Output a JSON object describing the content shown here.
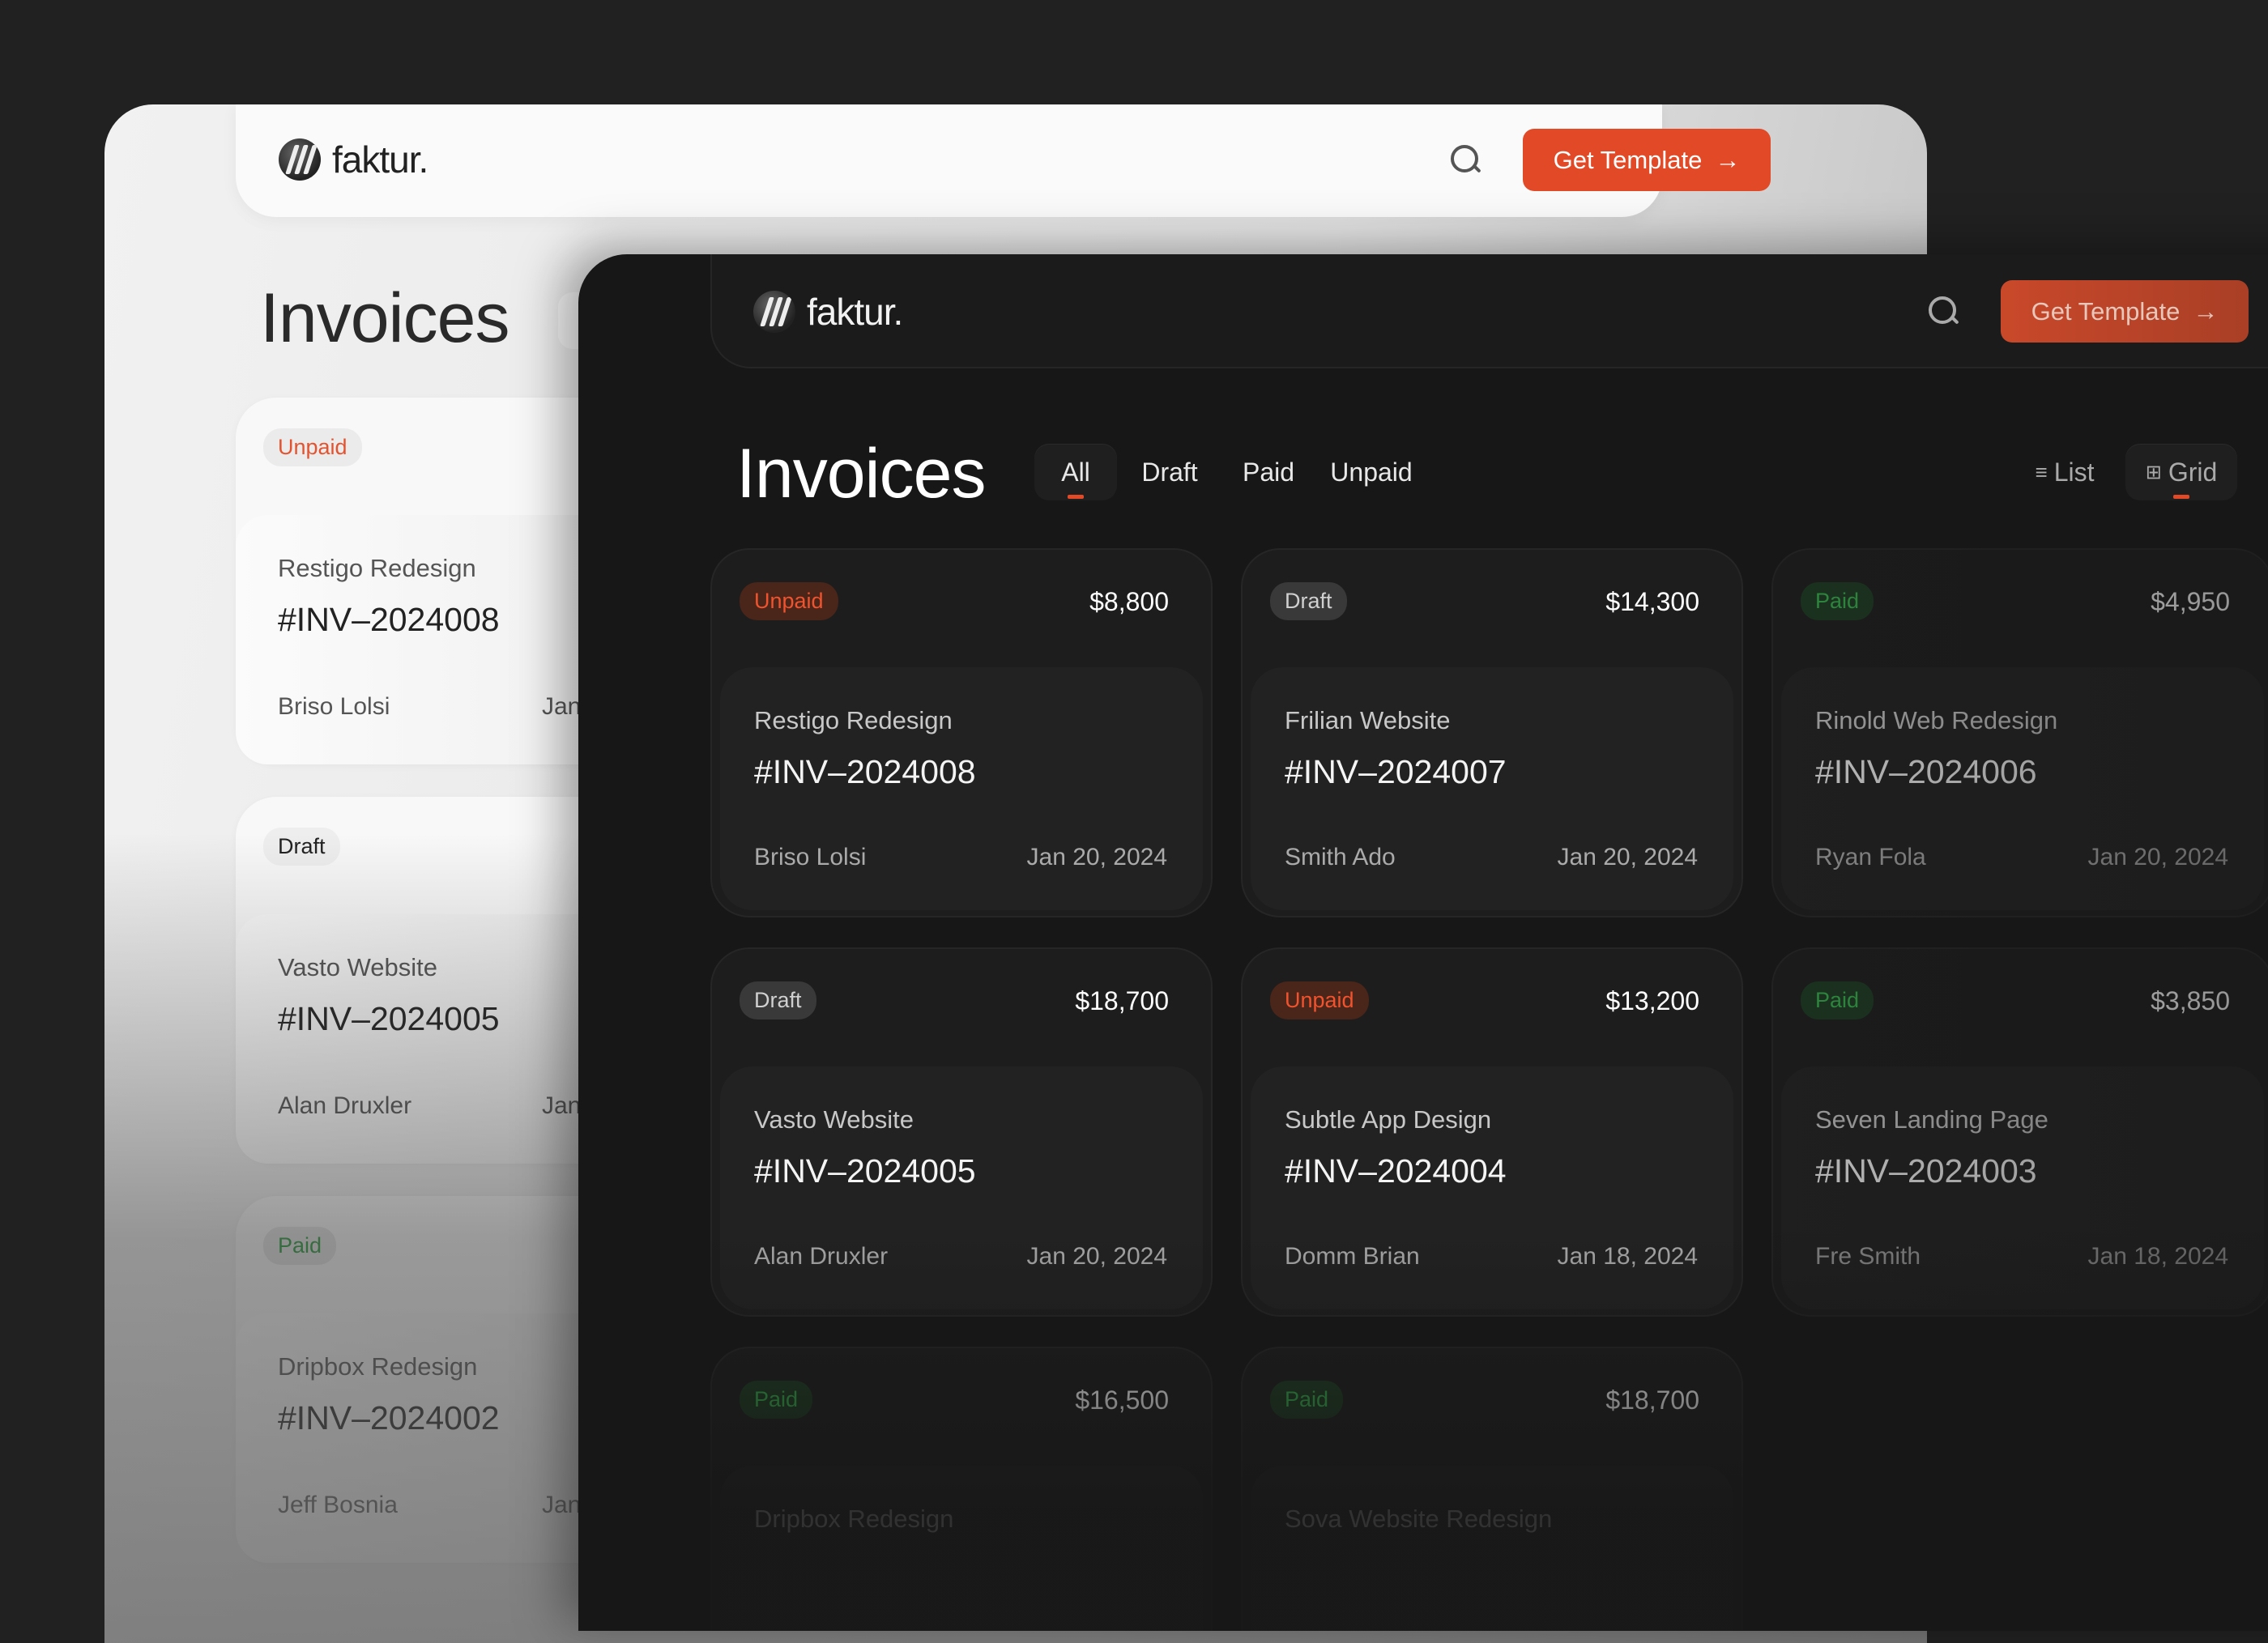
{
  "brand": "faktur.",
  "cta": "Get Template",
  "cta_icon": "arrow-right-icon",
  "accent": "#e24a27",
  "title": "Invoices",
  "tabs": [
    {
      "label": "All",
      "active": true
    },
    {
      "label": "Draft"
    },
    {
      "label": "Paid"
    },
    {
      "label": "Unpaid"
    }
  ],
  "views": [
    {
      "label": "List",
      "icon": "list-icon"
    },
    {
      "label": "Grid",
      "icon": "grid-icon",
      "active": true
    }
  ],
  "light_cards": [
    {
      "status": "Unpaid",
      "project": "Restigo Redesign",
      "id": "#INV–2024008",
      "client": "Briso Lolsi",
      "date": "Jan"
    },
    {
      "status": "Draft",
      "project": "Vasto Website",
      "id": "#INV–2024005",
      "client": "Alan Druxler",
      "date": "Jan"
    },
    {
      "status": "Paid",
      "project": "Dripbox Redesign",
      "id": "#INV–2024002",
      "client": "Jeff Bosnia",
      "date": "Jan"
    }
  ],
  "cards": [
    {
      "status": "Unpaid",
      "amount": "$8,800",
      "project": "Restigo Redesign",
      "id": "#INV–2024008",
      "client": "Briso Lolsi",
      "date": "Jan 20, 2024"
    },
    {
      "status": "Draft",
      "amount": "$14,300",
      "project": "Frilian Website",
      "id": "#INV–2024007",
      "client": "Smith Ado",
      "date": "Jan 20, 2024"
    },
    {
      "status": "Paid",
      "amount": "$4,950",
      "project": "Rinold Web Redesign",
      "id": "#INV–2024006",
      "client": "Ryan Fola",
      "date": "Jan 20, 2024"
    },
    {
      "status": "Draft",
      "amount": "$18,700",
      "project": "Vasto Website",
      "id": "#INV–2024005",
      "client": "Alan Druxler",
      "date": "Jan 20, 2024"
    },
    {
      "status": "Unpaid",
      "amount": "$13,200",
      "project": "Subtle App Design",
      "id": "#INV–2024004",
      "client": "Domm Brian",
      "date": "Jan 18, 2024"
    },
    {
      "status": "Paid",
      "amount": "$3,850",
      "project": "Seven Landing Page",
      "id": "#INV–2024003",
      "client": "Fre Smith",
      "date": "Jan 18, 2024"
    },
    {
      "status": "Paid",
      "amount": "$16,500",
      "project": "Dripbox Redesign"
    },
    {
      "status": "Paid",
      "amount": "$18,700",
      "project": "Sova Website Redesign"
    }
  ]
}
